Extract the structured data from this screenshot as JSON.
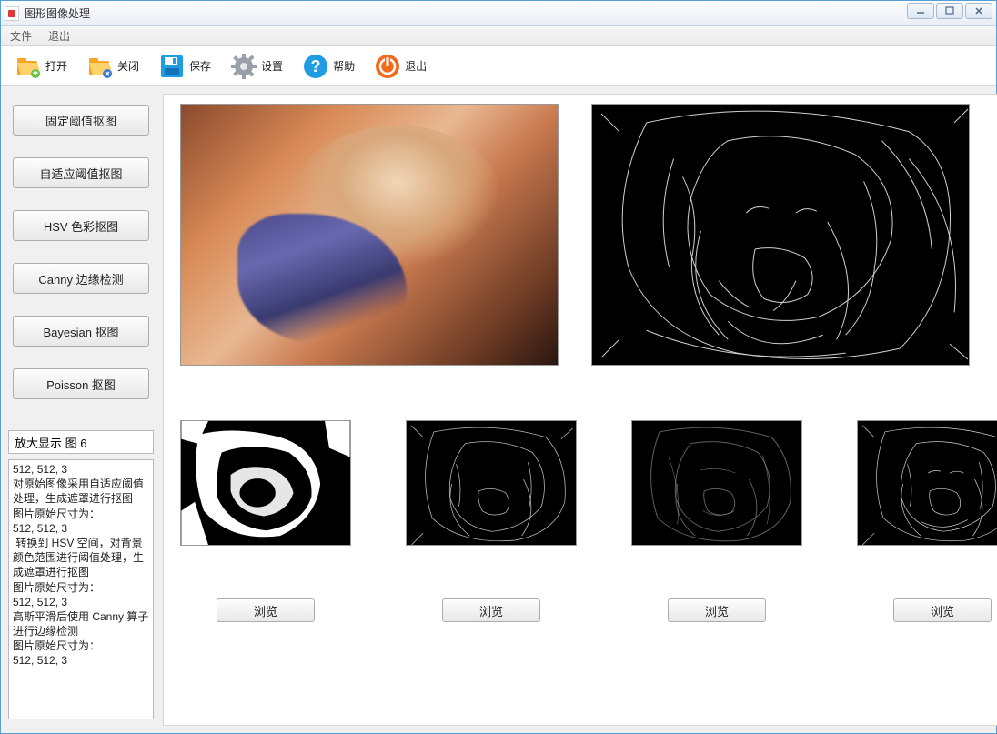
{
  "window": {
    "title": "图形图像处理"
  },
  "menu": {
    "file": "文件",
    "exit": "退出"
  },
  "toolbar": {
    "open": "打开",
    "close": "关闭",
    "save": "保存",
    "settings": "设置",
    "help": "帮助",
    "exit": "退出"
  },
  "sidebar": {
    "buttons": [
      "固定阈值抠图",
      "自适应阈值抠图",
      "HSV 色彩抠图",
      "Canny 边缘检测",
      "Bayesian 抠图",
      "Poisson 抠图"
    ],
    "zoom_input": "放大显示 图 6",
    "log_text": "512, 512, 3\n对原始图像采用自适应阈值处理，生成遮罩进行抠图\n图片原始尺寸为：\n512, 512, 3\n 转换到 HSV 空间，对背景颜色范围进行阈值处理，生成遮罩进行抠图\n图片原始尺寸为：\n512, 512, 3\n高斯平滑后使用 Canny 算子进行边缘检测\n图片原始尺寸为：\n512, 512, 3"
  },
  "browse_label": "浏览",
  "images": {
    "big_left_desc": "lena-color",
    "big_right_desc": "lena-canny-edges",
    "thumbs": [
      "lena-threshold-bw",
      "lena-adaptive-edges",
      "lena-soft-edges",
      "lena-fine-edges"
    ]
  }
}
